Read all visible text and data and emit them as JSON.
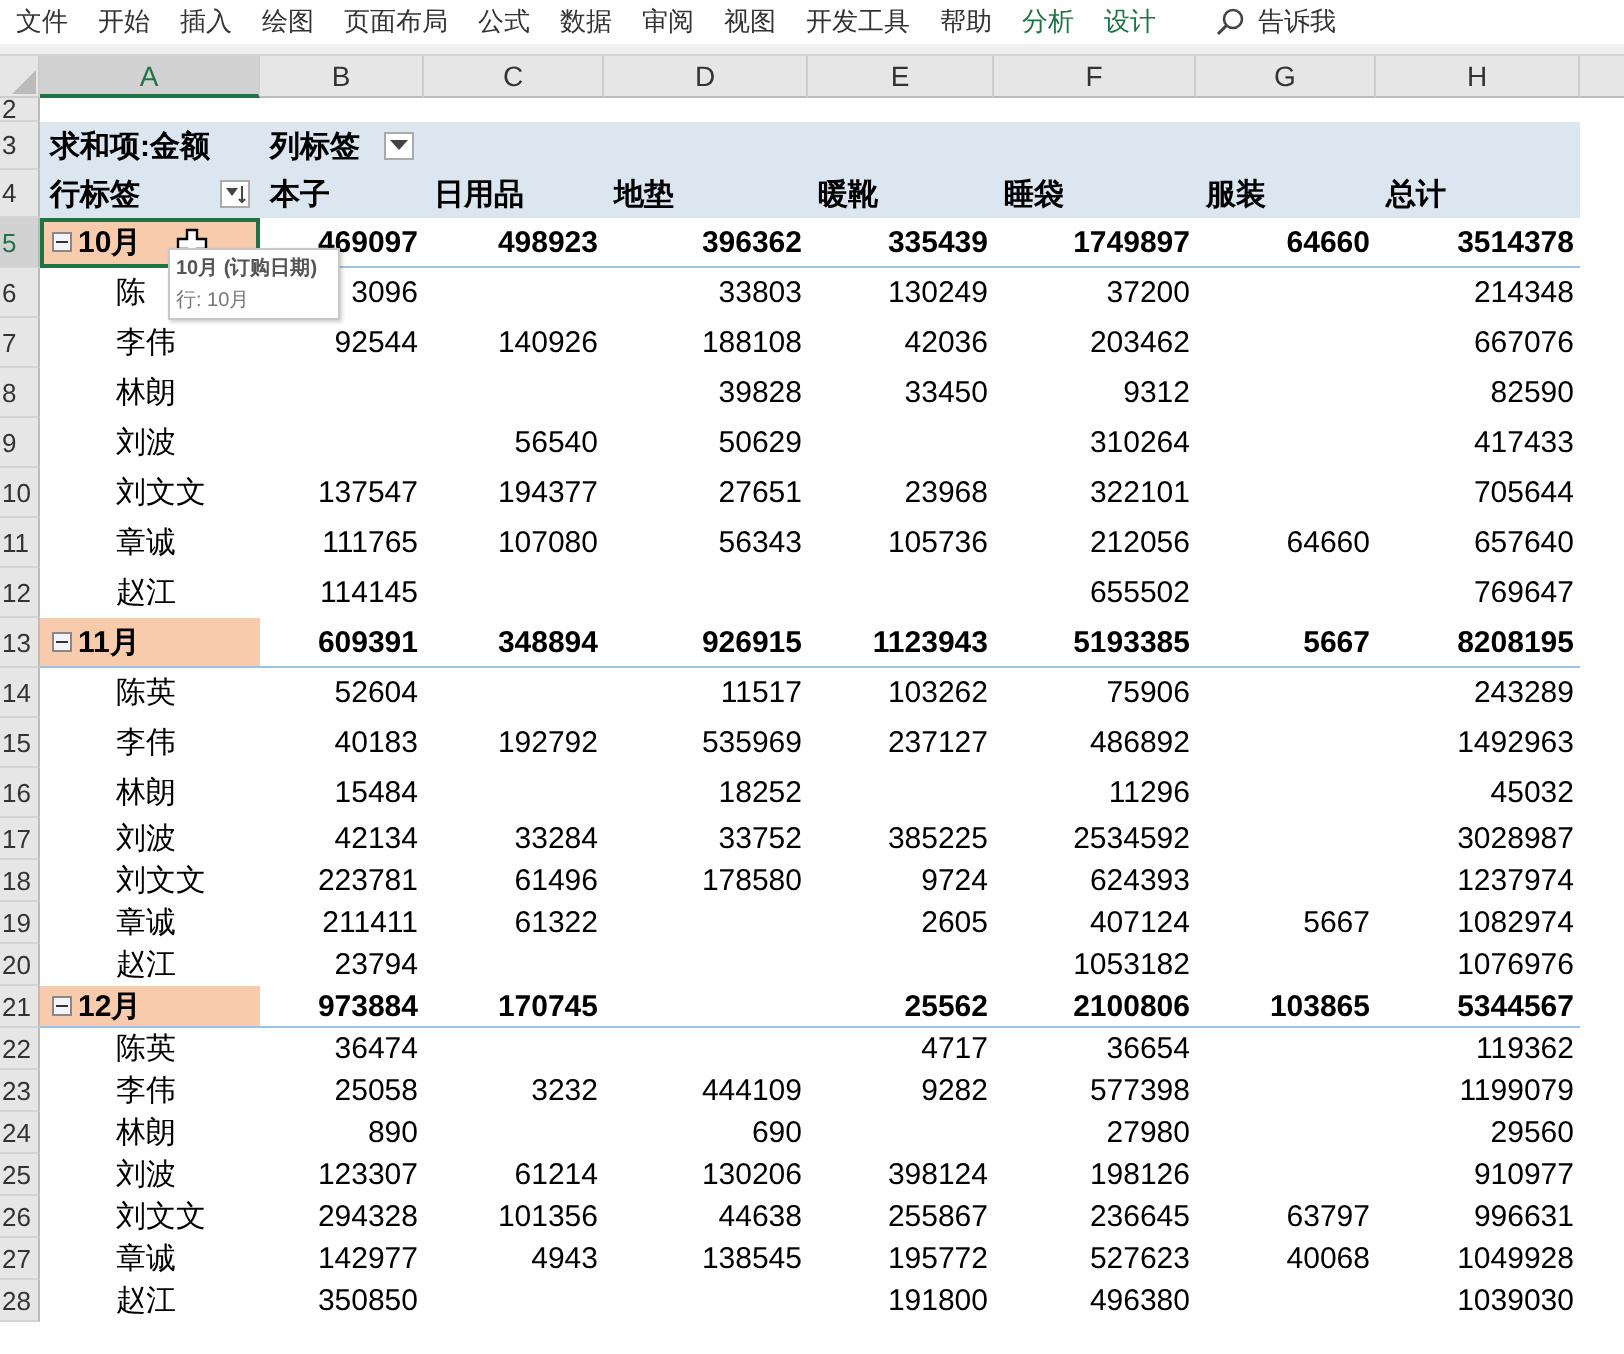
{
  "menu": [
    {
      "label": "文件",
      "contextual": false
    },
    {
      "label": "开始",
      "contextual": false
    },
    {
      "label": "插入",
      "contextual": false
    },
    {
      "label": "绘图",
      "contextual": false
    },
    {
      "label": "页面布局",
      "contextual": false
    },
    {
      "label": "公式",
      "contextual": false
    },
    {
      "label": "数据",
      "contextual": false
    },
    {
      "label": "审阅",
      "contextual": false
    },
    {
      "label": "视图",
      "contextual": false
    },
    {
      "label": "开发工具",
      "contextual": false
    },
    {
      "label": "帮助",
      "contextual": false
    },
    {
      "label": "分析",
      "contextual": true
    },
    {
      "label": "设计",
      "contextual": true
    }
  ],
  "tell_me": "告诉我",
  "columns": [
    {
      "label": "A",
      "selected": true
    },
    {
      "label": "B",
      "selected": false
    },
    {
      "label": "C",
      "selected": false
    },
    {
      "label": "D",
      "selected": false
    },
    {
      "label": "E",
      "selected": false
    },
    {
      "label": "F",
      "selected": false
    },
    {
      "label": "G",
      "selected": false
    },
    {
      "label": "H",
      "selected": false
    }
  ],
  "pivot": {
    "row2": "2",
    "row3": {
      "num": "3",
      "value_label": "求和项:金额",
      "column_labels": "列标签"
    },
    "row4": {
      "num": "4",
      "row_labels": "行标签",
      "headers": [
        "本子",
        "日用品",
        "地垫",
        "暖靴",
        "睡袋",
        "服装",
        "总计"
      ]
    }
  },
  "rows": [
    {
      "num": "5",
      "kind": "group",
      "label": "10月",
      "expanded": true,
      "selected": true,
      "cells": [
        "469097",
        "498923",
        "396362",
        "335439",
        "1749897",
        "64660",
        "3514378"
      ]
    },
    {
      "num": "6",
      "kind": "item",
      "label": "陈",
      "selected": false,
      "cells": [
        "3096",
        null,
        "33803",
        "130249",
        "37200",
        null,
        "214348"
      ]
    },
    {
      "num": "7",
      "kind": "item",
      "label": "李伟",
      "selected": false,
      "cells": [
        "92544",
        "140926",
        "188108",
        "42036",
        "203462",
        null,
        "667076"
      ]
    },
    {
      "num": "8",
      "kind": "item",
      "label": "林朗",
      "selected": false,
      "cells": [
        null,
        null,
        "39828",
        "33450",
        "9312",
        null,
        "82590"
      ]
    },
    {
      "num": "9",
      "kind": "item",
      "label": "刘波",
      "selected": false,
      "cells": [
        null,
        "56540",
        "50629",
        null,
        "310264",
        null,
        "417433"
      ]
    },
    {
      "num": "10",
      "kind": "item",
      "label": "刘文文",
      "selected": false,
      "cells": [
        "137547",
        "194377",
        "27651",
        "23968",
        "322101",
        null,
        "705644"
      ]
    },
    {
      "num": "11",
      "kind": "item",
      "label": "章诚",
      "selected": false,
      "cells": [
        "111765",
        "107080",
        "56343",
        "105736",
        "212056",
        "64660",
        "657640"
      ]
    },
    {
      "num": "12",
      "kind": "item",
      "label": "赵江",
      "selected": false,
      "cells": [
        "114145",
        null,
        null,
        null,
        "655502",
        null,
        "769647"
      ]
    },
    {
      "num": "13",
      "kind": "group",
      "label": "11月",
      "expanded": true,
      "selected": false,
      "cells": [
        "609391",
        "348894",
        "926915",
        "1123943",
        "5193385",
        "5667",
        "8208195"
      ]
    },
    {
      "num": "14",
      "kind": "item",
      "label": "陈英",
      "selected": false,
      "cells": [
        "52604",
        null,
        "11517",
        "103262",
        "75906",
        null,
        "243289"
      ]
    },
    {
      "num": "15",
      "kind": "item",
      "label": "李伟",
      "selected": false,
      "cells": [
        "40183",
        "192792",
        "535969",
        "237127",
        "486892",
        null,
        "1492963"
      ]
    },
    {
      "num": "16",
      "kind": "item",
      "label": "林朗",
      "selected": false,
      "cells": [
        "15484",
        null,
        "18252",
        null,
        "11296",
        null,
        "45032"
      ]
    },
    {
      "num": "17",
      "kind": "item",
      "label": "刘波",
      "selected": false,
      "cells": [
        "42134",
        "33284",
        "33752",
        "385225",
        "2534592",
        null,
        "3028987"
      ]
    },
    {
      "num": "18",
      "kind": "item",
      "label": "刘文文",
      "selected": false,
      "cells": [
        "223781",
        "61496",
        "178580",
        "9724",
        "624393",
        null,
        "1237974"
      ]
    },
    {
      "num": "19",
      "kind": "item",
      "label": "章诚",
      "selected": false,
      "cells": [
        "211411",
        "61322",
        null,
        "2605",
        "407124",
        "5667",
        "1082974"
      ]
    },
    {
      "num": "20",
      "kind": "item",
      "label": "赵江",
      "selected": false,
      "cells": [
        "23794",
        null,
        null,
        null,
        "1053182",
        null,
        "1076976"
      ]
    },
    {
      "num": "21",
      "kind": "group",
      "label": "12月",
      "expanded": true,
      "selected": false,
      "cells": [
        "973884",
        "170745",
        null,
        "25562",
        "2100806",
        "103865",
        "5344567"
      ]
    },
    {
      "num": "22",
      "kind": "item",
      "label": "陈英",
      "selected": false,
      "cells": [
        "36474",
        null,
        null,
        "4717",
        "36654",
        null,
        "119362"
      ]
    },
    {
      "num": "23",
      "kind": "item",
      "label": "李伟",
      "selected": false,
      "cells": [
        "25058",
        "3232",
        "444109",
        "9282",
        "577398",
        null,
        "1199079"
      ]
    },
    {
      "num": "24",
      "kind": "item",
      "label": "林朗",
      "selected": false,
      "cells": [
        "890",
        null,
        "690",
        null,
        "27980",
        null,
        "29560"
      ]
    },
    {
      "num": "25",
      "kind": "item",
      "label": "刘波",
      "selected": false,
      "cells": [
        "123307",
        "61214",
        "130206",
        "398124",
        "198126",
        null,
        "910977"
      ]
    },
    {
      "num": "26",
      "kind": "item",
      "label": "刘文文",
      "selected": false,
      "cells": [
        "294328",
        "101356",
        "44638",
        "255867",
        "236645",
        "63797",
        "996631"
      ]
    },
    {
      "num": "27",
      "kind": "item",
      "label": "章诚",
      "selected": false,
      "cells": [
        "142977",
        "4943",
        "138545",
        "195772",
        "527623",
        "40068",
        "1049928"
      ]
    },
    {
      "num": "28",
      "kind": "item",
      "label": "赵江",
      "selected": false,
      "cells": [
        "350850",
        null,
        null,
        "191800",
        "496380",
        null,
        "1039030"
      ]
    }
  ],
  "tooltip": {
    "title": "10月 (订购日期)",
    "line": "行: 10月"
  }
}
